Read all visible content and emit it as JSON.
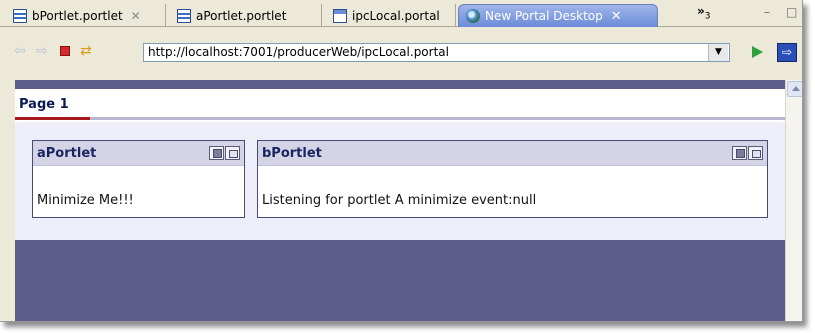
{
  "tabs": [
    {
      "label": "bPortlet.portlet",
      "icon": "document-icon",
      "close": "✕"
    },
    {
      "label": "aPortlet.portlet",
      "icon": "document-icon"
    },
    {
      "label": "ipcLocal.portal",
      "icon": "portal-file-icon"
    },
    {
      "label": "New Portal Desktop",
      "icon": "globe-icon",
      "close": "✕"
    }
  ],
  "tab_overflow": {
    "symbol": "»",
    "count": "3"
  },
  "window_controls": {
    "minimize": "–",
    "restore": "□"
  },
  "toolbar": {
    "back_icon": "⇦",
    "forward_icon": "⇨",
    "refresh_icon": "⇄",
    "url": "http://localhost:7001/producerWeb/ipcLocal.portal",
    "dropdown_icon": "▼",
    "ext_icon": "⇨"
  },
  "page": {
    "title": "Page 1"
  },
  "portlets": [
    {
      "title": "aPortlet",
      "body": "Minimize Me!!!"
    },
    {
      "title": "bPortlet",
      "body": "Listening for portlet A minimize event:null"
    }
  ],
  "colors": {
    "active_tab": "#7a96df",
    "portal_background": "#5d5d8c",
    "page_underline_active": "#a8181e",
    "portlet_header": "#d4d4e6"
  }
}
